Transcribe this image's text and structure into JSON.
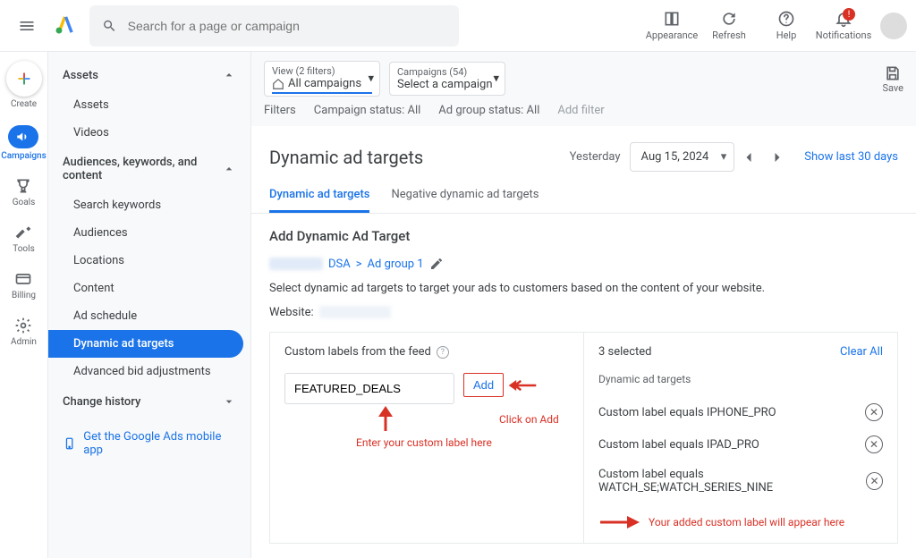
{
  "topbar": {
    "search_placeholder": "Search for a page or campaign",
    "actions": {
      "appearance": "Appearance",
      "refresh": "Refresh",
      "help": "Help",
      "notifications": "Notifications"
    }
  },
  "leftrail": {
    "create": "Create",
    "campaigns": "Campaigns",
    "goals": "Goals",
    "tools": "Tools",
    "billing": "Billing",
    "admin": "Admin"
  },
  "sidenav": {
    "assets": "Assets",
    "assets_sub": "Assets",
    "videos": "Videos",
    "audiences_group": "Audiences, keywords, and content",
    "search_keywords": "Search keywords",
    "audiences": "Audiences",
    "locations": "Locations",
    "content_item": "Content",
    "ad_schedule": "Ad schedule",
    "dynamic_targets": "Dynamic ad targets",
    "advanced_bid": "Advanced bid adjustments",
    "change_history": "Change history",
    "mobile_app": "Get the Google Ads mobile app"
  },
  "scope": {
    "view_small": "View (2 filters)",
    "view_big": "All campaigns",
    "camp_small": "Campaigns (54)",
    "camp_big": "Select a campaign",
    "save": "Save"
  },
  "filters": {
    "label": "Filters",
    "campaign_status": "Campaign status: All",
    "adgroup_status": "Ad group status: All",
    "add": "Add filter"
  },
  "header": {
    "title": "Dynamic ad targets",
    "date_label": "Yesterday",
    "date_value": "Aug 15, 2024",
    "show_last": "Show last 30 days"
  },
  "tabs": {
    "positive": "Dynamic ad targets",
    "negative": "Negative dynamic ad targets"
  },
  "panel": {
    "heading": "Add Dynamic Ad Target",
    "breadcrumb_dsa": "DSA",
    "breadcrumb_sep": ">",
    "breadcrumb_adgroup": "Ad group 1",
    "description": "Select dynamic ad targets to target your ads to customers based on the content of your website.",
    "website_label": "Website:"
  },
  "left_col": {
    "heading": "Custom labels from the feed",
    "input_value": "FEATURED_DEALS",
    "add_button": "Add"
  },
  "right_col": {
    "selected_count": "3 selected",
    "clear_all": "Clear All",
    "targets_head": "Dynamic ad targets",
    "rows": [
      "Custom label equals IPHONE_PRO",
      "Custom label equals IPAD_PRO",
      "Custom label equals WATCH_SE;WATCH_SERIES_NINE"
    ]
  },
  "annotations": {
    "enter_label": "Enter your custom label here",
    "click_add": "Click on Add",
    "appear_here": "Your added custom label will appear here"
  }
}
